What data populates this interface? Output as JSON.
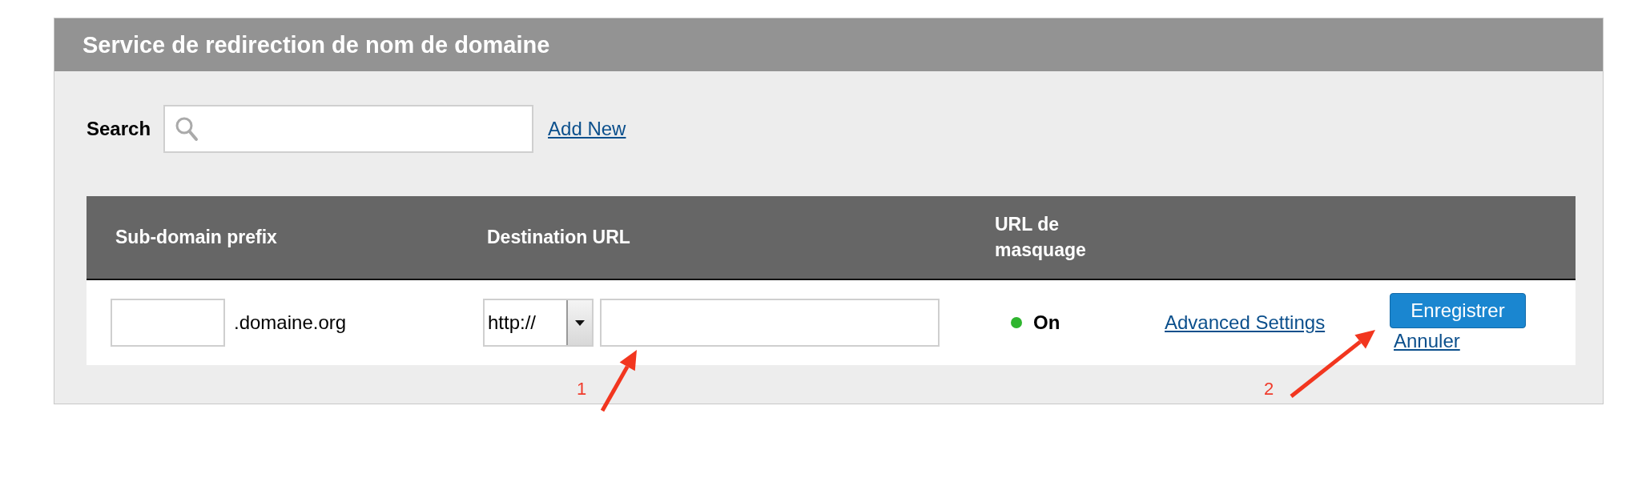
{
  "panel": {
    "title": "Service de redirection de nom de domaine"
  },
  "search": {
    "label": "Search",
    "link": "Add New"
  },
  "table": {
    "columns": [
      "Sub-domain prefix",
      "Destination URL",
      "URL de masquage"
    ],
    "row": {
      "suffix": ".domaine.org",
      "protocol": "http://",
      "masking": {
        "label": "On",
        "on": true
      },
      "advanced": "Advanced Settings",
      "save": "Enregistrer",
      "cancel": "Annuler"
    }
  },
  "annotations": [
    {
      "label": "1"
    },
    {
      "label": "2"
    }
  ]
}
